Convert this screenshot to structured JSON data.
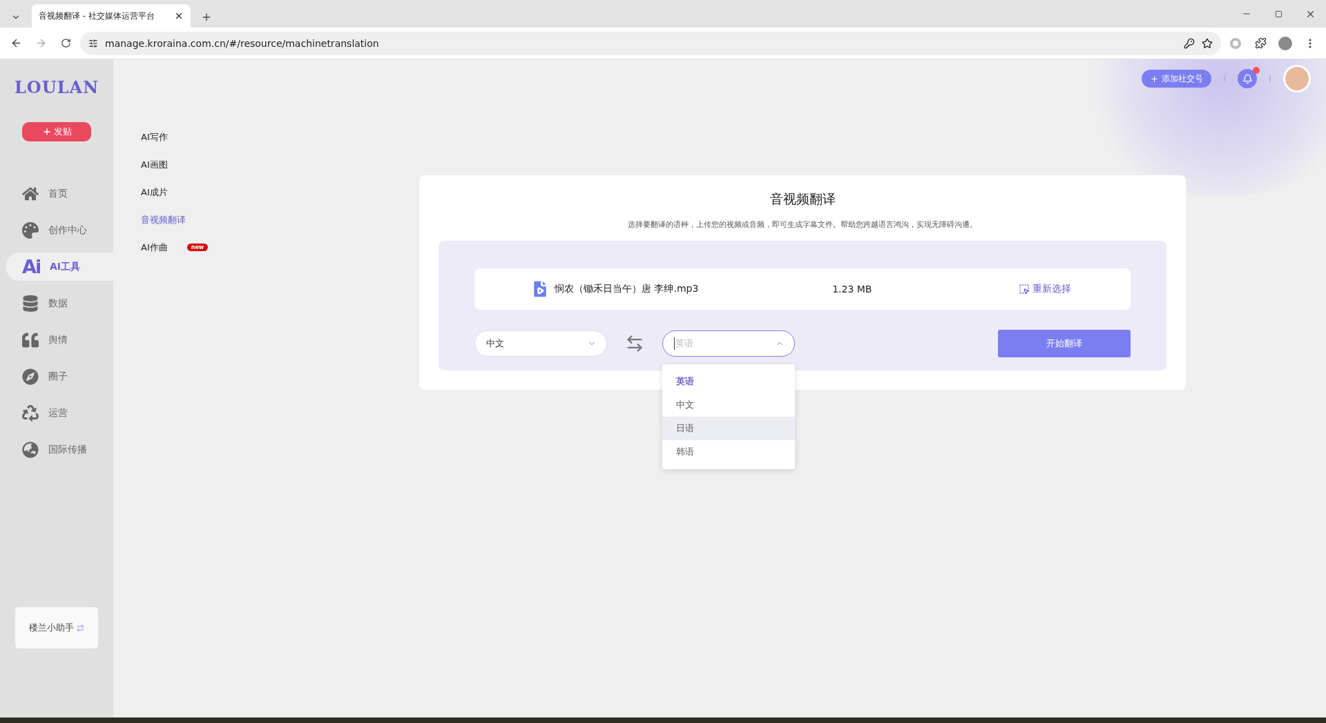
{
  "browser": {
    "tab_title": "音视频翻译 - 社交媒体运营平台",
    "url": "manage.kroraina.com.cn/#/resource/machinetranslation"
  },
  "sidebar": {
    "logo": "LOULAN",
    "post_button": "发贴",
    "items": [
      {
        "label": "首页",
        "selected": false
      },
      {
        "label": "创作中心",
        "selected": false
      },
      {
        "icon_text": "Ai",
        "label": "AI工具",
        "selected": true
      },
      {
        "label": "数据",
        "selected": false
      },
      {
        "label": "舆情",
        "selected": false
      },
      {
        "label": "圈子",
        "selected": false
      },
      {
        "label": "运营",
        "selected": false
      },
      {
        "label": "国际传播",
        "selected": false
      }
    ],
    "assistant": "楼兰小助手"
  },
  "submenu": [
    {
      "label": "AI写作",
      "selected": false
    },
    {
      "label": "AI画图",
      "selected": false
    },
    {
      "label": "AI成片",
      "selected": false
    },
    {
      "label": "音视频翻译",
      "selected": true
    },
    {
      "label": "AI作曲",
      "selected": false,
      "badge": "new"
    }
  ],
  "header": {
    "add_account": "添加社交号",
    "notification_unread": true
  },
  "card": {
    "title": "音视频翻译",
    "description": "选择要翻译的语种，上传您的视频或音频，即可生成字幕文件。帮助您跨越语言鸿沟，实现无障碍沟通。",
    "file": {
      "name": "悯农（锄禾日当午）唐 李绅.mp3",
      "size": "1.23 MB",
      "reselect": "重新选择"
    },
    "source_language": "中文",
    "target_placeholder": "英语",
    "dropdown_open": true,
    "options": [
      {
        "label": "英语",
        "selected": true,
        "hovered": false
      },
      {
        "label": "中文",
        "selected": false,
        "hovered": false
      },
      {
        "label": "日语",
        "selected": false,
        "hovered": true
      },
      {
        "label": "韩语",
        "selected": false,
        "hovered": false
      }
    ],
    "start_button": "开始翻译"
  }
}
